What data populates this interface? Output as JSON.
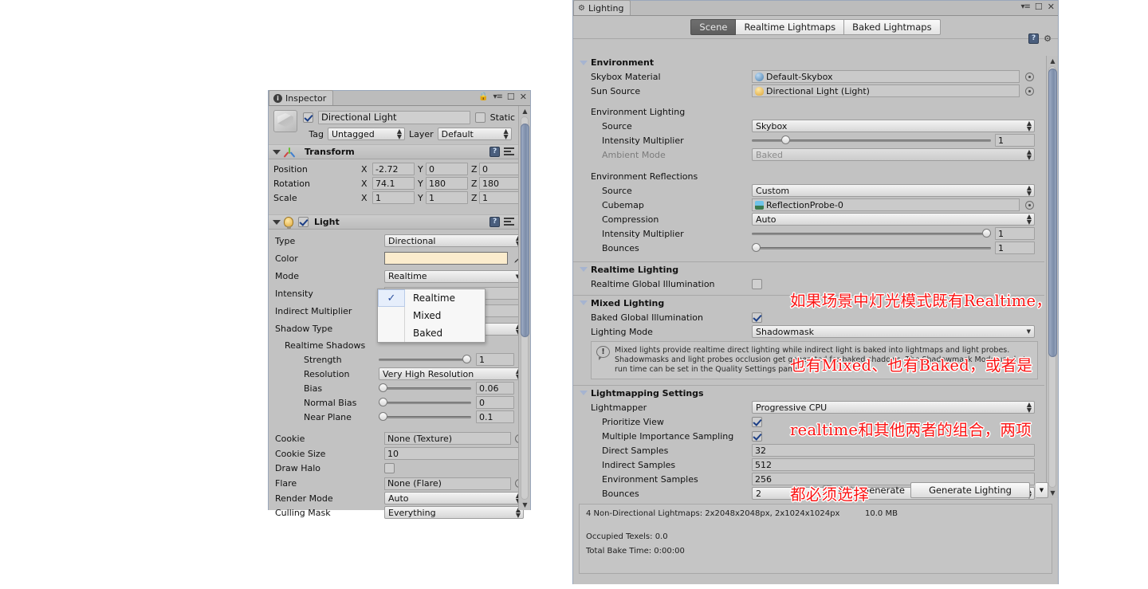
{
  "inspector": {
    "tab_label": "Inspector",
    "tab_icon": "info-icon",
    "titlebar_icons": [
      "lock-icon",
      "menu-icon",
      "maximize-icon",
      "close-icon"
    ],
    "object": {
      "enabled": true,
      "name": "Directional Light",
      "static_label": "Static",
      "static_checked": false,
      "tag_label": "Tag",
      "tag_value": "Untagged",
      "layer_label": "Layer",
      "layer_value": "Default"
    },
    "transform": {
      "title": "Transform",
      "rows": [
        {
          "label": "Position",
          "x": "-2.72",
          "y": "0",
          "z": "0"
        },
        {
          "label": "Rotation",
          "x": "74.1",
          "y": "180",
          "z": "180"
        },
        {
          "label": "Scale",
          "x": "1",
          "y": "1",
          "z": "1"
        }
      ],
      "axis_labels": {
        "x": "X",
        "y": "Y",
        "z": "Z"
      }
    },
    "light": {
      "title": "Light",
      "enabled": true,
      "type_label": "Type",
      "type_value": "Directional",
      "color_label": "Color",
      "color_value": "#fbeccd",
      "mode_label": "Mode",
      "mode_value": "Realtime",
      "intensity_label": "Intensity",
      "indirect_multiplier_label": "Indirect Multiplier",
      "shadow_type_label": "Shadow Type",
      "realtime_shadows_label": "Realtime Shadows",
      "strength_label": "Strength",
      "strength_value": "1",
      "resolution_label": "Resolution",
      "resolution_value": "Very High Resolution",
      "bias_label": "Bias",
      "bias_value": "0.06",
      "normal_bias_label": "Normal Bias",
      "normal_bias_value": "0",
      "near_plane_label": "Near Plane",
      "near_plane_value": "0.1",
      "cookie_label": "Cookie",
      "cookie_value": "None (Texture)",
      "cookie_size_label": "Cookie Size",
      "cookie_size_value": "10",
      "draw_halo_label": "Draw Halo",
      "draw_halo_checked": false,
      "flare_label": "Flare",
      "flare_value": "None (Flare)",
      "render_mode_label": "Render Mode",
      "render_mode_value": "Auto",
      "culling_mask_label": "Culling Mask",
      "culling_mask_value": "Everything"
    },
    "mode_dropdown": {
      "open": true,
      "selected": "Realtime",
      "options": [
        "Realtime",
        "Mixed",
        "Baked"
      ]
    }
  },
  "lighting": {
    "tab_label": "Lighting",
    "tab_icon": "lighting-icon",
    "titlebar_icons": [
      "menu-icon",
      "maximize-icon",
      "close-icon"
    ],
    "header_icons": [
      "help-book-icon",
      "gear-icon"
    ],
    "tabs": [
      {
        "label": "Scene",
        "active": true
      },
      {
        "label": "Realtime Lightmaps",
        "active": false
      },
      {
        "label": "Baked Lightmaps",
        "active": false
      }
    ],
    "environment": {
      "title": "Environment",
      "skybox_material_label": "Skybox Material",
      "skybox_material_value": "Default-Skybox",
      "sun_source_label": "Sun Source",
      "sun_source_value": "Directional Light (Light)",
      "env_lighting_title": "Environment Lighting",
      "env_lighting_source_label": "Source",
      "env_lighting_source_value": "Skybox",
      "env_intensity_label": "Intensity Multiplier",
      "env_intensity_value": "1",
      "ambient_mode_label": "Ambient Mode",
      "ambient_mode_value": "Baked",
      "env_reflections_title": "Environment Reflections",
      "refl_source_label": "Source",
      "refl_source_value": "Custom",
      "cubemap_label": "Cubemap",
      "cubemap_value": "ReflectionProbe-0",
      "compression_label": "Compression",
      "compression_value": "Auto",
      "refl_intensity_label": "Intensity Multiplier",
      "refl_intensity_value": "1",
      "bounces_label": "Bounces",
      "bounces_value": "1"
    },
    "realtime_lighting": {
      "title": "Realtime Lighting",
      "realtime_gi_label": "Realtime Global Illumination",
      "realtime_gi_checked": false
    },
    "mixed_lighting": {
      "title": "Mixed Lighting",
      "baked_gi_label": "Baked Global Illumination",
      "baked_gi_checked": true,
      "lighting_mode_label": "Lighting Mode",
      "lighting_mode_value": "Shadowmask",
      "info_text": "Mixed lights provide realtime direct lighting while indirect light is baked into lightmaps and light probes. Shadowmasks and light probes occlusion get generated for baked shadows. The Shadowmask Mode used at run time can be set in the Quality Settings panel."
    },
    "lightmapping_settings": {
      "title": "Lightmapping Settings",
      "lightmapper_label": "Lightmapper",
      "lightmapper_value": "Progressive CPU",
      "prioritize_view_label": "Prioritize View",
      "prioritize_view_checked": true,
      "mis_label": "Multiple Importance Sampling",
      "mis_checked": true,
      "direct_samples_label": "Direct Samples",
      "direct_samples_value": "32",
      "indirect_samples_label": "Indirect Samples",
      "indirect_samples_value": "512",
      "environment_samples_label": "Environment Samples",
      "environment_samples_value": "256",
      "bounces_label": "Bounces",
      "bounces_value": "2"
    },
    "footer": {
      "auto_generate_label": "Auto Generate",
      "auto_generate_checked": false,
      "generate_button_label": "Generate Lighting"
    },
    "stats": {
      "lightmaps_line": "4 Non-Directional Lightmaps: 2x2048x2048px, 2x1024x1024px",
      "memory": "10.0 MB",
      "occupied_texels": "Occupied Texels: 0.0",
      "total_bake_time": "Total Bake Time: 0:00:00"
    }
  },
  "annotation": {
    "color": "#fb1414",
    "line1": "如果场景中灯光模式既有Realtime，",
    "line2": "也有Mixed、也有Baked，或者是",
    "line3": "realtime和其他两者的组合，两项",
    "line4": "都必须选择"
  }
}
